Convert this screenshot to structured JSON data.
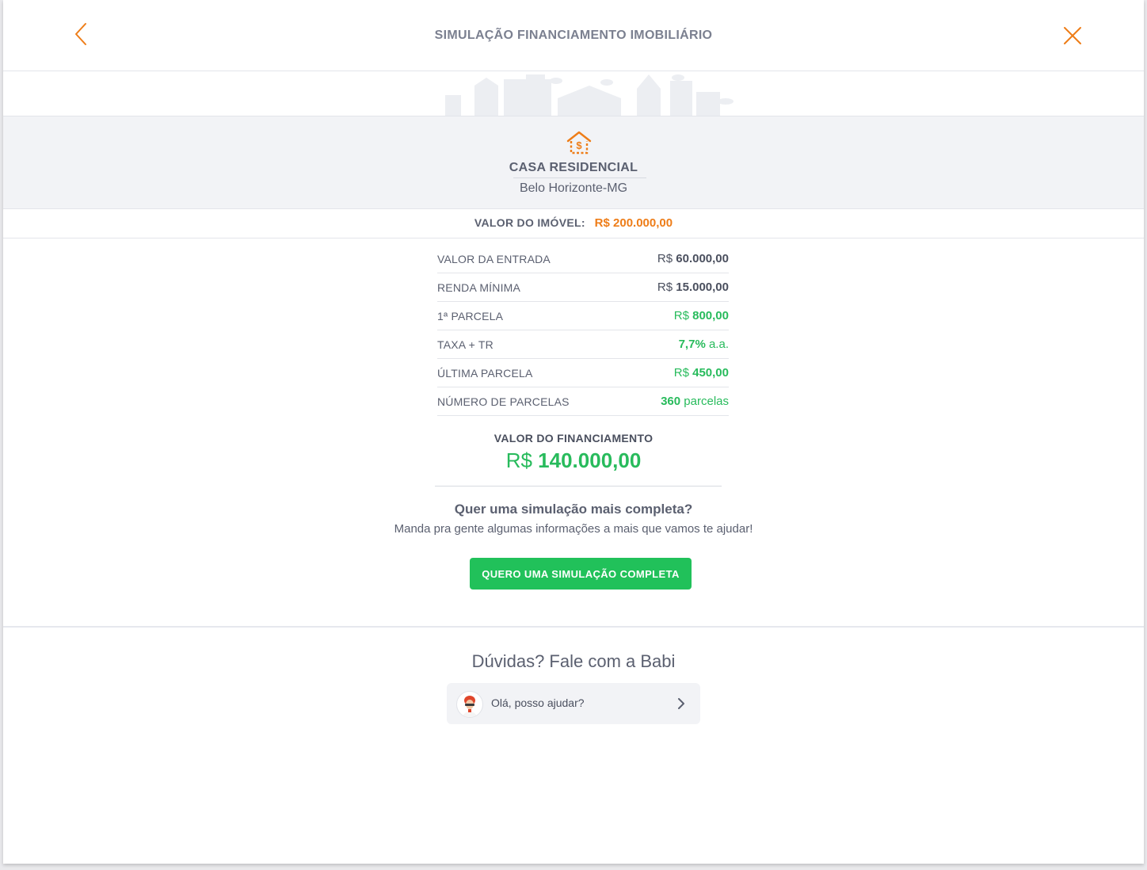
{
  "header": {
    "title": "SIMULAÇÃO FINANCIAMENTO IMOBILIÁRIO",
    "back_icon": "chevron-left-icon",
    "close_icon": "close-icon",
    "accent_color": "#ee7d18"
  },
  "property": {
    "icon": "house-dollar-icon",
    "type": "CASA RESIDENCIAL",
    "city": "Belo Horizonte-MG"
  },
  "valor_imovel": {
    "label": "VALOR DO IMÓVEL:",
    "value": "R$ 200.000,00"
  },
  "details": [
    {
      "label": "VALOR DA ENTRADA",
      "prefix": "R$",
      "value": "60.000,00",
      "suffix": "",
      "color": "gray"
    },
    {
      "label": "RENDA MÍNIMA",
      "prefix": "R$",
      "value": "15.000,00",
      "suffix": "",
      "color": "gray"
    },
    {
      "label": "1ª PARCELA",
      "prefix": "R$",
      "value": "800,00",
      "suffix": "",
      "color": "green"
    },
    {
      "label": "TAXA + TR",
      "prefix": "",
      "value": "7,7%",
      "suffix": "a.a.",
      "color": "green"
    },
    {
      "label": "ÚLTIMA PARCELA",
      "prefix": "R$",
      "value": "450,00",
      "suffix": "",
      "color": "green"
    },
    {
      "label": "NÚMERO DE PARCELAS",
      "prefix": "",
      "value": "360",
      "suffix": "parcelas",
      "color": "green"
    }
  ],
  "financing": {
    "label": "VALOR DO FINANCIAMENTO",
    "currency": "R$",
    "value": "140.000,00"
  },
  "cta": {
    "title": "Quer uma simulação mais completa?",
    "subtitle": "Manda pra gente algumas informações a mais que vamos te ajudar!",
    "button_label": "QUERO UMA SIMULAÇÃO COMPLETA",
    "button_color": "#21c15a"
  },
  "help": {
    "title": "Dúvidas? Fale com a Babi",
    "chat_text": "Olá, posso ajudar?",
    "avatar_icon": "babi-avatar-icon",
    "arrow_icon": "chevron-right-icon"
  },
  "colors": {
    "green": "#28bb5c",
    "orange": "#ee7d18",
    "text": "#4a4f5e"
  }
}
